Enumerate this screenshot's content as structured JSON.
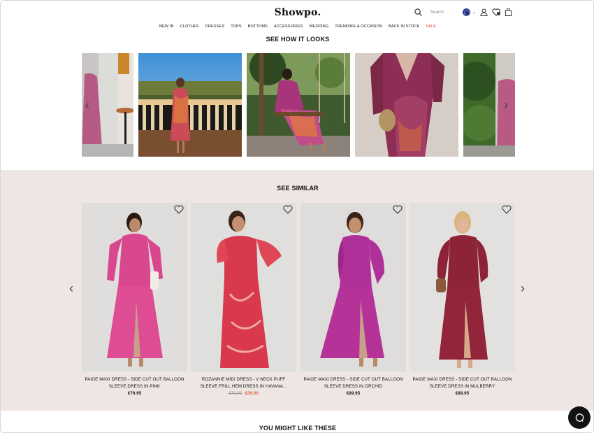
{
  "header": {
    "logo": "Showpo.",
    "search_placeholder": "Search",
    "nav": [
      "NEW IN",
      "CLOTHES",
      "DRESSES",
      "TOPS",
      "BOTTOMS",
      "ACCESSORIES",
      "WEDDING",
      "TRENDING & OCCASION",
      "BACK IN STOCK",
      "SALE"
    ],
    "cart_count": "0"
  },
  "looks": {
    "title": "SEE HOW IT LOOKS"
  },
  "similar": {
    "title": "SEE SIMILAR",
    "products": [
      {
        "name_line1": "PAIGE MAXI DRESS - SIDE CUT OUT BALLOON",
        "name_line2": "SLEEVE DRESS IN PINK",
        "price": "€79.95",
        "old_price": "",
        "sale_price": ""
      },
      {
        "name_line1": "ROZANNIE MIDI DRESS - V NECK PUFF",
        "name_line2": "SLEEVE FRILL HEM DRESS IN HAVANA...",
        "price": "",
        "old_price": "€79.95",
        "sale_price": "€39.00"
      },
      {
        "name_line1": "PAIGE MAXI DRESS - SIDE CUT OUT BALLOON",
        "name_line2": "SLEEVE DRESS IN ORCHID",
        "price": "€89.95",
        "old_price": "",
        "sale_price": ""
      },
      {
        "name_line1": "PAIGE MAXI DRESS - SIDE CUT OUT BALLOON",
        "name_line2": "SLEEVE DRESS IN MULBERRY",
        "price": "€89.95",
        "old_price": "",
        "sale_price": ""
      }
    ]
  },
  "might_like": {
    "title": "YOU MIGHT LIKE THESE"
  },
  "colors": {
    "sale": "#e03a3a",
    "similar_bg": "#eee6e2",
    "price_sale": "#e0583f"
  }
}
